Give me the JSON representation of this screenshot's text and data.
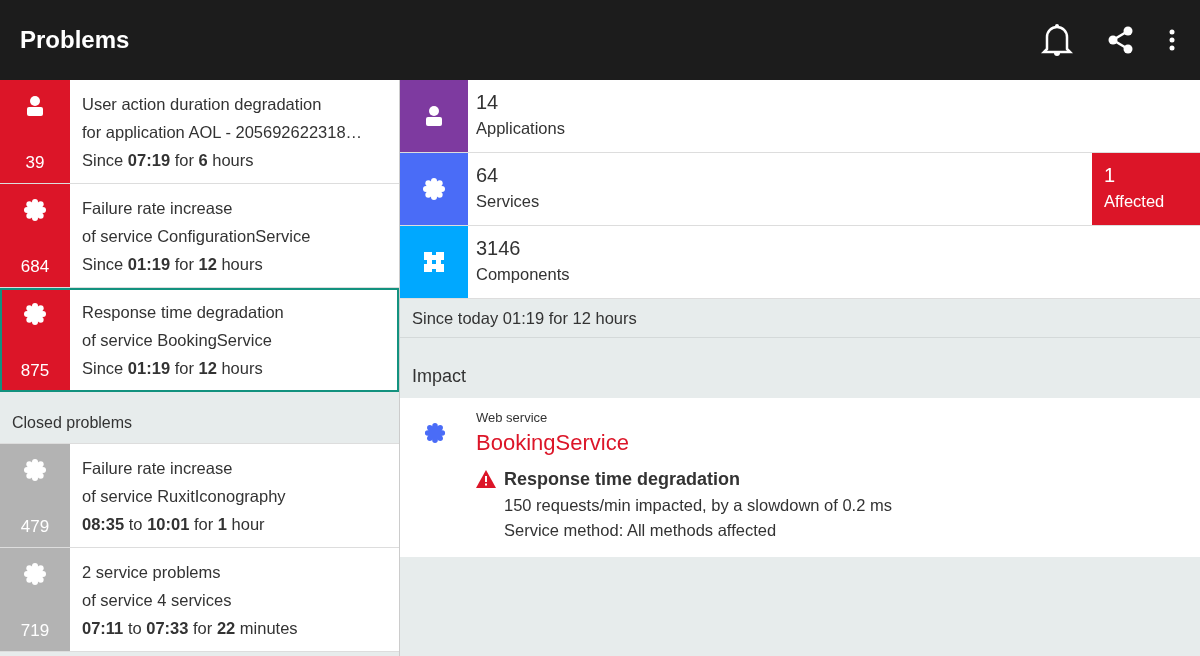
{
  "app_bar": {
    "title": "Problems"
  },
  "open_problems": [
    {
      "kind": "application",
      "count": "39",
      "title": "User action duration degradation",
      "subject": "for application AOL - 205692622318…",
      "timing": "Since **07:19** for **6** hours",
      "selected": false
    },
    {
      "kind": "service",
      "count": "684",
      "title": "Failure rate increase",
      "subject": "of service ConfigurationService",
      "timing": "Since **01:19** for **12** hours",
      "selected": false
    },
    {
      "kind": "service",
      "count": "875",
      "title": "Response time degradation",
      "subject": "of service BookingService",
      "timing": "Since **01:19** for **12** hours",
      "selected": true
    }
  ],
  "closed_header": "Closed problems",
  "closed_problems": [
    {
      "kind": "service",
      "count": "479",
      "title": "Failure rate increase",
      "subject": "of service RuxitIconography",
      "timing": "**08:35** to **10:01** for **1** hour",
      "selected": false
    },
    {
      "kind": "service",
      "count": "719",
      "title": "2 service problems",
      "subject": "of service 4 services",
      "timing": "**07:11** to **07:33** for **22** minutes",
      "selected": false
    }
  ],
  "entities": [
    {
      "kind": "application",
      "color": "#7e3aa0",
      "count": "14",
      "label": "Applications"
    },
    {
      "kind": "service",
      "color": "#4a6cf7",
      "count": "64",
      "label": "Services",
      "affected": {
        "count": "1",
        "label": "Affected"
      }
    },
    {
      "kind": "component",
      "color": "#00a8ff",
      "count": "3146",
      "label": "Components"
    }
  ],
  "since": "Since today 01:19 for 12 hours",
  "impact": {
    "header": "Impact",
    "type": "Web service",
    "name": "BookingService",
    "problem": "Response time degradation",
    "details": [
      "150 requests/min impacted, by a slowdown of 0.2 ms",
      "Service method: All methods affected"
    ]
  }
}
